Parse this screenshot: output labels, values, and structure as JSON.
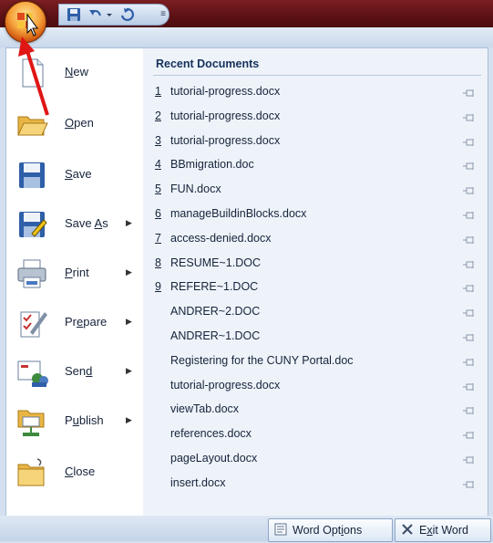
{
  "left_menu": {
    "items": [
      {
        "key": "new",
        "pre": "",
        "u": "N",
        "post": "ew",
        "has_submenu": false,
        "icon": "new-document-icon"
      },
      {
        "key": "open",
        "pre": "",
        "u": "O",
        "post": "pen",
        "has_submenu": false,
        "icon": "open-folder-icon"
      },
      {
        "key": "save",
        "pre": "",
        "u": "S",
        "post": "ave",
        "has_submenu": false,
        "icon": "save-icon"
      },
      {
        "key": "save-as",
        "pre": "Save ",
        "u": "A",
        "post": "s",
        "has_submenu": true,
        "icon": "save-as-icon"
      },
      {
        "key": "print",
        "pre": "",
        "u": "P",
        "post": "rint",
        "has_submenu": true,
        "icon": "printer-icon"
      },
      {
        "key": "prepare",
        "pre": "Pr",
        "u": "e",
        "post": "pare",
        "has_submenu": true,
        "icon": "prepare-icon"
      },
      {
        "key": "send",
        "pre": "Sen",
        "u": "d",
        "post": "",
        "has_submenu": true,
        "icon": "send-icon"
      },
      {
        "key": "publish",
        "pre": "P",
        "u": "u",
        "post": "blish",
        "has_submenu": true,
        "icon": "publish-icon"
      },
      {
        "key": "close",
        "pre": "",
        "u": "C",
        "post": "lose",
        "has_submenu": false,
        "icon": "close-document-icon"
      }
    ]
  },
  "recent": {
    "title": "Recent Documents",
    "documents": [
      {
        "num": "1",
        "name": "tutorial-progress.docx"
      },
      {
        "num": "2",
        "name": "tutorial-progress.docx"
      },
      {
        "num": "3",
        "name": "tutorial-progress.docx"
      },
      {
        "num": "4",
        "name": "BBmigration.doc"
      },
      {
        "num": "5",
        "name": "FUN.docx"
      },
      {
        "num": "6",
        "name": "manageBuildinBlocks.docx"
      },
      {
        "num": "7",
        "name": "access-denied.docx"
      },
      {
        "num": "8",
        "name": "RESUME~1.DOC"
      },
      {
        "num": "9",
        "name": "REFERE~1.DOC"
      },
      {
        "num": "",
        "name": "ANDRER~2.DOC"
      },
      {
        "num": "",
        "name": "ANDRER~1.DOC"
      },
      {
        "num": "",
        "name": "Registering for the CUNY Portal.doc"
      },
      {
        "num": "",
        "name": "tutorial-progress.docx"
      },
      {
        "num": "",
        "name": "viewTab.docx"
      },
      {
        "num": "",
        "name": "references.docx"
      },
      {
        "num": "",
        "name": "pageLayout.docx"
      },
      {
        "num": "",
        "name": "insert.docx"
      }
    ]
  },
  "bottom": {
    "word_options": {
      "pre": "Word Opt",
      "u": "i",
      "post": "ons"
    },
    "exit_word": {
      "pre": "E",
      "u": "x",
      "post": "it Word"
    }
  },
  "qat": {
    "dropdown_glyph": "≡"
  },
  "colors": {
    "titlebar": "#5e1216",
    "menu_bg": "#d4e0ef",
    "recent_bg": "#eef3fa",
    "annotation_arrow": "#e01515"
  }
}
